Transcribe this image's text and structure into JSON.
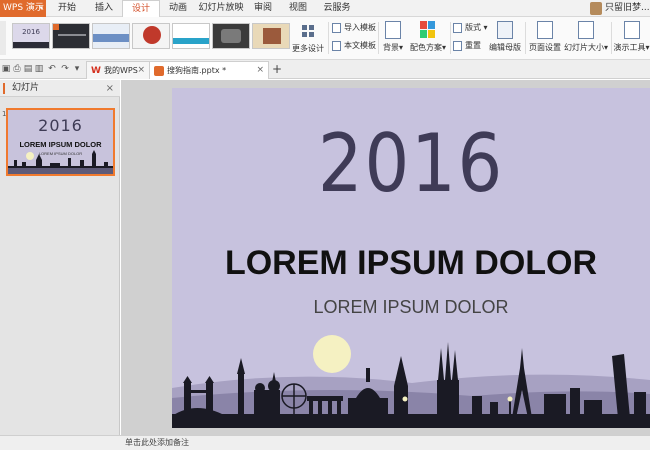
{
  "app": {
    "name": "WPS 演示"
  },
  "menu": {
    "tabs": [
      {
        "label": "开始"
      },
      {
        "label": "插入"
      },
      {
        "label": "设计",
        "active": true
      },
      {
        "label": "动画"
      },
      {
        "label": "幻灯片放映"
      },
      {
        "label": "审阅"
      },
      {
        "label": "视图"
      },
      {
        "label": "云服务"
      }
    ],
    "user_name": "只留旧梦..."
  },
  "ribbon": {
    "more_design": "更多设计",
    "import_template": "导入模板",
    "body_template": "本文模板",
    "background": "背景",
    "color_scheme": "配色方案",
    "layout": "版式",
    "reset": "重置",
    "edit_master": "编辑母版",
    "page_setup": "页面设置",
    "slide_size": "幻灯片大小",
    "presenter_tools": "演示工具",
    "theme_thumb_year": "2016"
  },
  "doc_tabs": [
    {
      "label": "我的WPS",
      "active": false
    },
    {
      "label": "搜狗指南.pptx *",
      "active": true
    }
  ],
  "left_panel": {
    "title": "幻灯片",
    "slide_number": "1",
    "thumb": {
      "year": "2016",
      "title": "LOREM IPSUM DOLOR",
      "subtitle": "LOREM IPSUM DOLOR"
    },
    "add_label": "+"
  },
  "slide": {
    "year": "2016",
    "title": "LOREM IPSUM DOLOR",
    "subtitle": "LOREM IPSUM DOLOR",
    "background_color": "#c7c2de",
    "moon_color": "#f5f1c2",
    "silhouette_color": "#1a1a24"
  },
  "status": {
    "notes_placeholder": "单击此处添加备注"
  },
  "colors": {
    "accent": "#e06a2c",
    "active_tab_text": "#d4502a"
  }
}
